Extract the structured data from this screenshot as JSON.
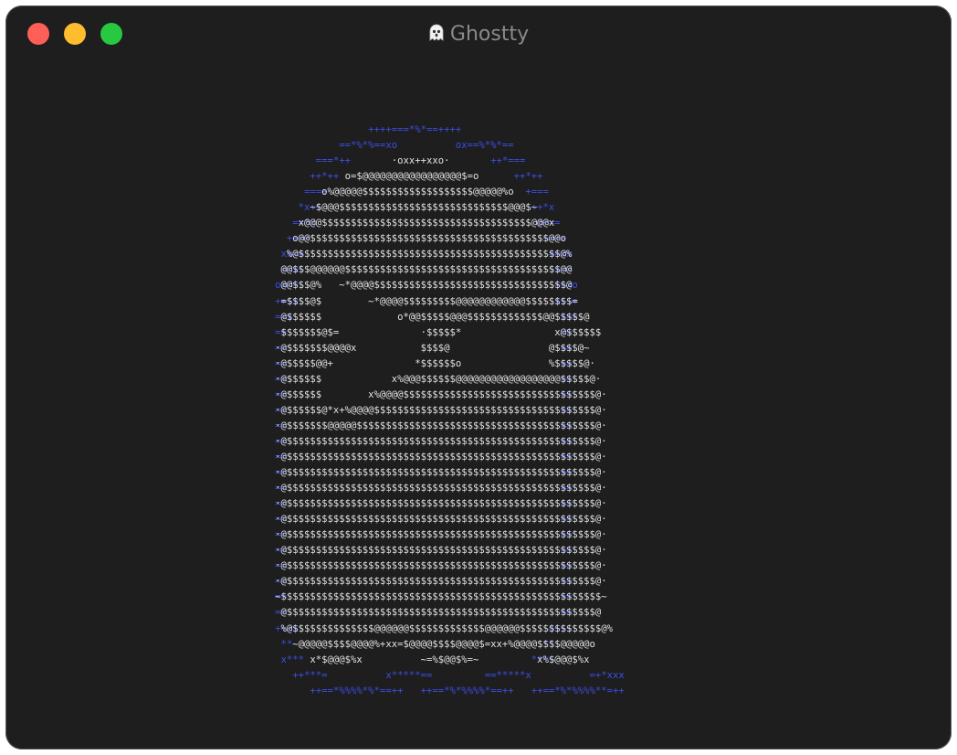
{
  "window": {
    "title": "Ghostty",
    "title_icon": "ghost-icon",
    "colors": {
      "background": "#1e1e1f",
      "title_text": "#8a8a8c",
      "traffic_red": "#fe5f57",
      "traffic_yellow": "#febc2e",
      "traffic_green": "#28c840",
      "ascii_outline": "#3b4ee0",
      "ascii_body": "#e0e0e0"
    }
  },
  "terminal": {
    "outline_lines": [
      "                   ++++===*%*==++++                  ",
      "              ==*%*%==xo          ox==%*%*==              ",
      "          ===*++                        ++*===          ",
      "         ++*++                              ++*++         ",
      "        ===+                                  +===        ",
      "       *x++                                    ++*x       ",
      "      ==*x                                      o+==      ",
      "     ++=+                                        +=++     ",
      "    xx==                                          ==xx    ",
      "    ==x~                                          ~x==    ",
      "   ox==                                            ==xo   ",
      "   +++x                                            x+++   ",
      "   ==x                                              x==   ",
      "   ==                                               ==   ",
      "   ==                                               ==   ",
      "   ==                                               ==   ",
      "   ==                                               ==   ",
      "   ==                                               ==   ",
      "   ==                                               ==   ",
      "   ==                                               ==   ",
      "   ==                                               ==   ",
      "   ==                                               ==   ",
      "   ==                                               ==   ",
      "   ==                                               ==   ",
      "   ==                                               ==   ",
      "   ==                                               ==   ",
      "   ==                                               ==   ",
      "   ==                                               ==   ",
      "   ==                                               ==   ",
      "   ==                                               ==   ",
      "   ==                                               ==   ",
      "   ==                                               ==   ",
      "   +++x                                           o+++   ",
      "    **                                           **    ",
      "    x***                                       ***+    ",
      "      ++***=          x*****==         ==*****x          =+*xxx      ",
      "         ++==*%%%%*%*==++   ++==*%*%%%%*==++   ++==*%*%%%%**=++         "
    ],
    "body_lines": [
      "                                                      ",
      "                                                      ",
      "                       ·oxx++xxo·                     ",
      "               o=$@@@@@@@@@@@@@@@@@$=o                ",
      "           o%@@@@@$$$$$$$$$$$$$$$$$$$@@@@@%o           ",
      "         ~$@@@$$$$$$$$$$$$$$$$$$$$$$$$$$$$$@@@$~         ",
      "       x@@@$$$$$$$$$$$$$$$$$$$$$$$$$$$$$$$$$$$$@@@x       ",
      "      o@@$$$$$$$$$$$$$$$$$$$$$$$$$$$$$$$$$$$$$$$$$@@o      ",
      "     %@$$$$$$$$$$$$$$$$$$$$$$$$$$$$$$$$$$$$$$$$$$$$$@%     ",
      "    @@$$$@@@@@@$$$$$$$$$$$$$$$$$$$$$$$$$$$$$$$$$$$$$@@    ",
      "    @@$$$@%   ~*@@@@$$$$$$$$$$$$$$$$$$$$$$$$$$$$$$$$$@    ",
      "    =$$$$@$        ~*@@@@$$$$$$$$$@@@@@@@@@@@@$$$$$$$$=    ",
      "    @$$$$$$             o*@@$$$$$@@@$$$$$$$$$$$$$@@$$$$$@    ",
      "    $$$$$$$@$=              ·$$$$$*                x@$$$$$$    ",
      "   ·@$$$$$$$@@@@x           $$$$@                 @$$$$@~   ",
      "   ·@$$$$$@@+              *$$$$$$o               %$$$$$@·   ",
      "   ·@$$$$$$            x%@@@$$$$$$@@@@@@@@@@@@@@@@@@$$$$$@·   ",
      "   ·@$$$$$$        x%@@@@$$$$$$$$$$$$$$$$$$$$$$$$$$$$$$$$$@·   ",
      "   ·@$$$$$$@*x+%@@@@$$$$$$$$$$$$$$$$$$$$$$$$$$$$$$$$$$$$$$@·   ",
      "   ·@$$$$$$$@@@@@$$$$$$$$$$$$$$$$$$$$$$$$$$$$$$$$$$$$$$$$$@·   ",
      "   ·@$$$$$$$$$$$$$$$$$$$$$$$$$$$$$$$$$$$$$$$$$$$$$$$$$$$$$@·   ",
      "   ·@$$$$$$$$$$$$$$$$$$$$$$$$$$$$$$$$$$$$$$$$$$$$$$$$$$$$$@·   ",
      "   ·@$$$$$$$$$$$$$$$$$$$$$$$$$$$$$$$$$$$$$$$$$$$$$$$$$$$$$@·   ",
      "   ·@$$$$$$$$$$$$$$$$$$$$$$$$$$$$$$$$$$$$$$$$$$$$$$$$$$$$$@·   ",
      "   ·@$$$$$$$$$$$$$$$$$$$$$$$$$$$$$$$$$$$$$$$$$$$$$$$$$$$$$@·   ",
      "   ·@$$$$$$$$$$$$$$$$$$$$$$$$$$$$$$$$$$$$$$$$$$$$$$$$$$$$$@·   ",
      "   ·@$$$$$$$$$$$$$$$$$$$$$$$$$$$$$$$$$$$$$$$$$$$$$$$$$$$$$@·   ",
      "   ·@$$$$$$$$$$$$$$$$$$$$$$$$$$$$$$$$$$$$$$$$$$$$$$$$$$$$$@·   ",
      "   ·@$$$$$$$$$$$$$$$$$$$$$$$$$$$$$$$$$$$$$$$$$$$$$$$$$$$$$@·   ",
      "   ·@$$$$$$$$$$$$$$$$$$$$$$$$$$$$$$$$$$$$$$$$$$$$$$$$$$$$$@·   ",
      "   ~$$$$$$$$$$$$$$$$$$$$$$$$$$$$$$$$$$$$$$$$$$$$$$$$$$$$$$$~   ",
      "    @$$$$$$$$$$$$$$$$$$$$$$$$$$$$$$$$$$$$$$$$$$$$$$$$$$$$$@    ",
      "    %@$$$$$$$$$$$$$$@@@@@@$$$$$$$$$$$$$@@@@@@$$$$$$$$$$$$$$@%    ",
      "      ~@@@@@$$$$@@@@%+xx=$@@@@$$$$@@@@$=xx+%@@@@$$$$@@@@@o     ",
      "         x*$@@@$%x          ~=%$@@$%=~          x%$@@@$%x         ",
      "                                                      ",
      "                                                      "
    ]
  }
}
